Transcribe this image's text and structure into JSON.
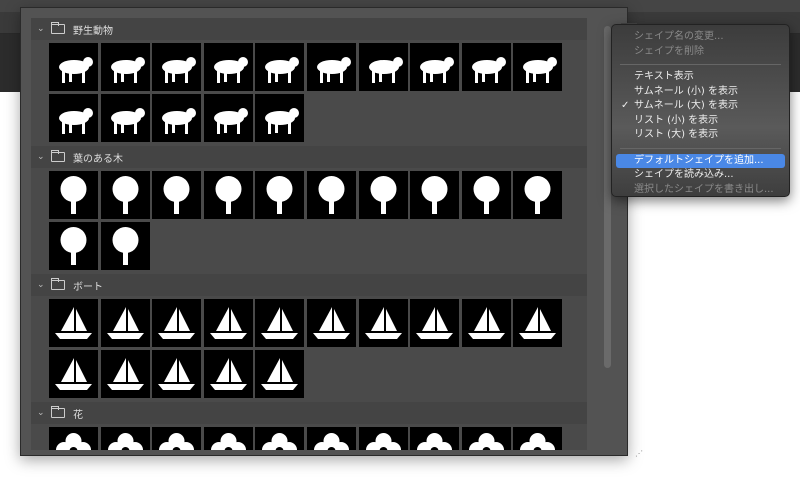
{
  "groups": [
    {
      "name": "野生動物",
      "kind": "animal",
      "count": 15
    },
    {
      "name": "葉のある木",
      "kind": "tree",
      "count": 12
    },
    {
      "name": "ボート",
      "kind": "boat",
      "count": 15
    },
    {
      "name": "花",
      "kind": "flower",
      "count": 10
    }
  ],
  "icons": {
    "gear": "gear-icon",
    "folder": "folder-icon",
    "chevron": "chevron-down-icon",
    "resize": "resize-grip-icon"
  },
  "menu": {
    "items": [
      {
        "label": "シェイプ名の変更...",
        "disabled": true
      },
      {
        "label": "シェイプを削除",
        "disabled": true
      },
      {
        "sep": true
      },
      {
        "label": "テキスト表示"
      },
      {
        "label": "サムネール (小) を表示"
      },
      {
        "label": "サムネール (大) を表示",
        "checked": true
      },
      {
        "label": "リスト (小) を表示"
      },
      {
        "label": "リスト (大) を表示"
      },
      {
        "sep": true
      },
      {
        "label": "デフォルトシェイプを追加...",
        "highlighted": true
      },
      {
        "label": "シェイプを読み込み..."
      },
      {
        "label": "選択したシェイプを書き出し...",
        "disabled": true
      }
    ],
    "checkmark": "✓",
    "highlight_color": "#4a88e6"
  }
}
